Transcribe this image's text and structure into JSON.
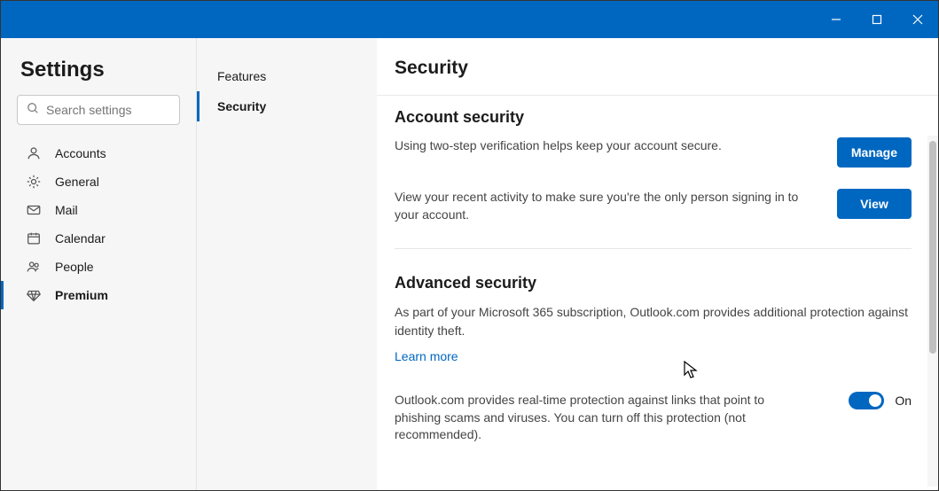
{
  "titlebar": {
    "min": "−",
    "max": "□",
    "close": "✕"
  },
  "sidebar": {
    "title": "Settings",
    "search_placeholder": "Search settings",
    "items": [
      {
        "label": "Accounts",
        "icon": "person"
      },
      {
        "label": "General",
        "icon": "gear"
      },
      {
        "label": "Mail",
        "icon": "mail"
      },
      {
        "label": "Calendar",
        "icon": "calendar"
      },
      {
        "label": "People",
        "icon": "people"
      },
      {
        "label": "Premium",
        "icon": "diamond",
        "selected": true
      }
    ]
  },
  "middle": {
    "items": [
      {
        "label": "Features"
      },
      {
        "label": "Security",
        "selected": true
      }
    ]
  },
  "content": {
    "title": "Security",
    "account_security": {
      "heading": "Account security",
      "two_step_text": "Using two-step verification helps keep your account secure.",
      "manage_btn": "Manage",
      "activity_text": "View your recent activity to make sure you're the only person signing in to your account.",
      "view_btn": "View"
    },
    "advanced_security": {
      "heading": "Advanced security",
      "description": "As part of your Microsoft 365 subscription, Outlook.com provides additional protection against identity theft.",
      "learn_more": "Learn more",
      "phishing_text": "Outlook.com provides real-time protection against links that point to phishing scams and viruses. You can turn off this protection (not recommended).",
      "toggle_label": "On",
      "toggle_state": true
    }
  }
}
